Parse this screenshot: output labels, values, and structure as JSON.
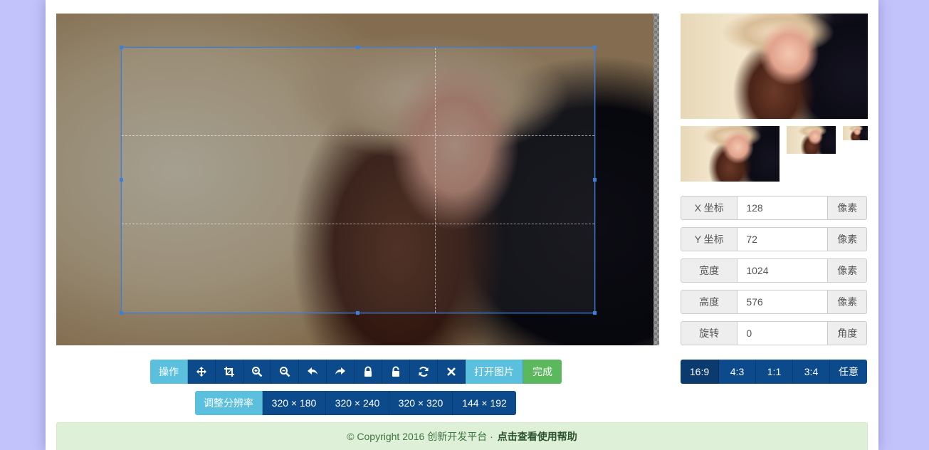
{
  "cropper": {
    "image_alt": "portrait photo of a woman wearing a hat"
  },
  "fields": [
    {
      "label": "X 坐标",
      "value": "128",
      "unit": "像素"
    },
    {
      "label": "Y 坐标",
      "value": "72",
      "unit": "像素"
    },
    {
      "label": "宽度",
      "value": "1024",
      "unit": "像素"
    },
    {
      "label": "高度",
      "value": "576",
      "unit": "像素"
    },
    {
      "label": "旋转",
      "value": "0",
      "unit": "角度"
    }
  ],
  "aspect_ratios": [
    "16:9",
    "4:3",
    "1:1",
    "3:4",
    "任意"
  ],
  "toolbar": {
    "operate_label": "操作",
    "icons": [
      "move-icon",
      "crop-icon",
      "zoom-in-icon",
      "zoom-out-icon",
      "rotate-left-icon",
      "rotate-right-icon",
      "lock-icon",
      "unlock-icon",
      "reset-icon",
      "clear-icon"
    ],
    "open_label": "打开图片",
    "done_label": "完成"
  },
  "resolution": {
    "label": "调整分辨率",
    "options": [
      "320 × 180",
      "320 × 240",
      "320 × 320",
      "144 × 192"
    ]
  },
  "footer": {
    "copyright": "© Copyright 2016 创新开发平台 ·",
    "help_link": "点击查看使用帮助"
  },
  "colors": {
    "info": "#5bc0de",
    "primary_dark": "#0c4a8c",
    "success": "#5cb85c",
    "footer_bg": "#dff0d8",
    "crop_border": "#3b7fd9"
  }
}
